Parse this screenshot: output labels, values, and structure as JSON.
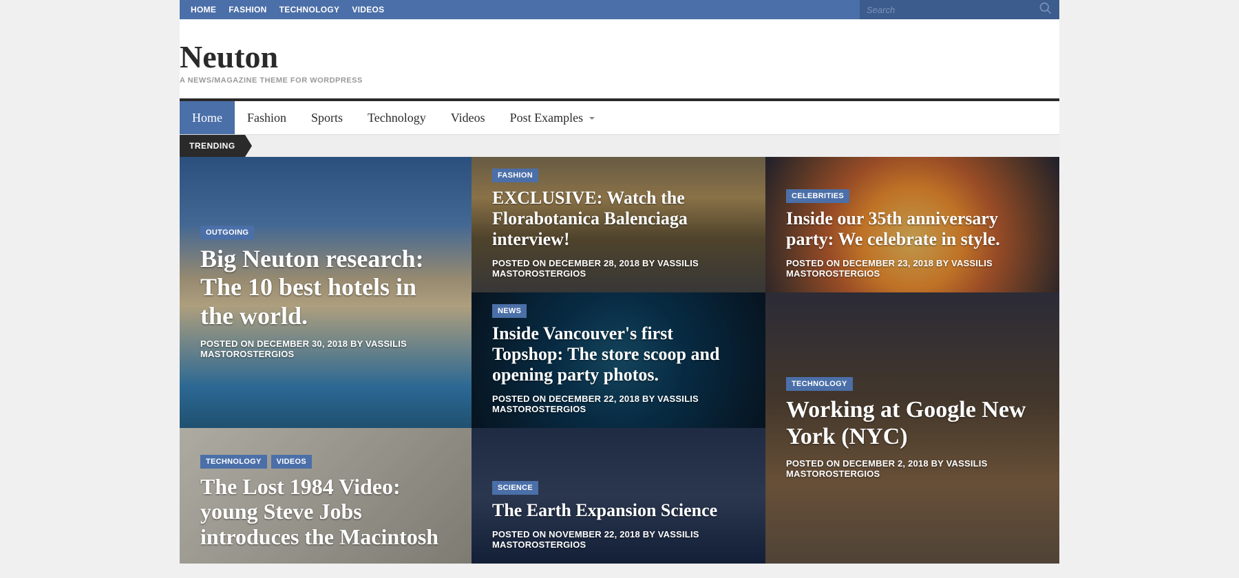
{
  "topnav": [
    "HOME",
    "FASHION",
    "TECHNOLOGY",
    "VIDEOS"
  ],
  "search": {
    "placeholder": "Search"
  },
  "site": {
    "title": "Neuton",
    "tagline": "A NEWS/MAGAZINE THEME FOR WORDPRESS"
  },
  "mainnav": [
    {
      "label": "Home",
      "active": true
    },
    {
      "label": "Fashion"
    },
    {
      "label": "Sports"
    },
    {
      "label": "Technology"
    },
    {
      "label": "Videos"
    },
    {
      "label": "Post Examples",
      "dropdown": true
    }
  ],
  "trending_label": "TRENDING",
  "posts": {
    "hero": {
      "cats": [
        "OUTGOING"
      ],
      "title": "Big Neuton research: The 10 best hotels in the world.",
      "meta": "POSTED ON DECEMBER 30, 2018 BY VASSILIS MASTOROSTERGIOS"
    },
    "p1": {
      "cats": [
        "FASHION"
      ],
      "title": "EXCLUSIVE: Watch the Florabotanica Balenciaga interview!",
      "meta": "POSTED ON DECEMBER 28, 2018 BY VASSILIS MASTOROSTERGIOS"
    },
    "p2": {
      "cats": [
        "CELEBRITIES"
      ],
      "title": "Inside our 35th anniversary party: We celebrate in style.",
      "meta": "POSTED ON DECEMBER 23, 2018 BY VASSILIS MASTOROSTERGIOS"
    },
    "p3": {
      "cats": [
        "NEWS"
      ],
      "title": "Inside Vancouver's first Topshop: The store scoop and opening party photos.",
      "meta": "POSTED ON DECEMBER 22, 2018 BY VASSILIS MASTOROSTERGIOS"
    },
    "p4": {
      "cats": [
        "TECHNOLOGY"
      ],
      "title": "Working at Google New York (NYC)",
      "meta": "POSTED ON DECEMBER 2, 2018 BY VASSILIS MASTOROSTERGIOS"
    },
    "p5": {
      "cats": [
        "TECHNOLOGY",
        "VIDEOS"
      ],
      "title": "The Lost 1984 Video: young Steve Jobs introduces the Macintosh",
      "meta": ""
    },
    "p6": {
      "cats": [
        "SCIENCE"
      ],
      "title": "The Earth Expansion Science",
      "meta": "POSTED ON NOVEMBER 22, 2018 BY VASSILIS MASTOROSTERGIOS"
    }
  }
}
